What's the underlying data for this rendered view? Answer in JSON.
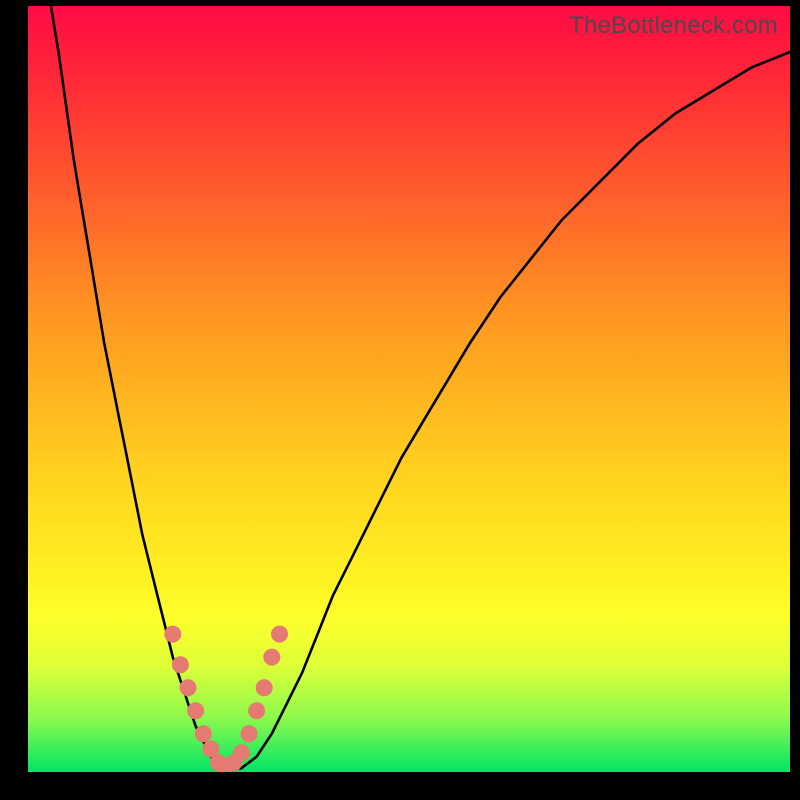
{
  "watermark": "TheBottleneck.com",
  "colors": {
    "gradient_top": "#ff0b47",
    "gradient_bottom": "#00e566",
    "curve": "#000000",
    "dots": "#e47a72",
    "frame": "#000000"
  },
  "chart_data": {
    "type": "line",
    "title": "",
    "xlabel": "",
    "ylabel": "",
    "xlim": [
      0,
      100
    ],
    "ylim": [
      0,
      100
    ],
    "x": [
      3,
      4,
      5,
      6,
      7,
      8,
      9,
      10,
      11,
      12,
      13,
      14,
      15,
      16,
      17,
      18,
      19,
      20,
      21,
      22,
      23,
      24,
      25,
      26,
      28,
      30,
      32,
      34,
      36,
      38,
      40,
      43,
      46,
      49,
      52,
      55,
      58,
      62,
      66,
      70,
      75,
      80,
      85,
      90,
      95,
      100
    ],
    "values": [
      100,
      94,
      87,
      80,
      74,
      68,
      62,
      56,
      51,
      46,
      41,
      36,
      31,
      27,
      23,
      19,
      15,
      12,
      9,
      6,
      4,
      2,
      1,
      0.3,
      0.5,
      2,
      5,
      9,
      13,
      18,
      23,
      29,
      35,
      41,
      46,
      51,
      56,
      62,
      67,
      72,
      77,
      82,
      86,
      89,
      92,
      94
    ],
    "notch_x": 25,
    "dots": [
      {
        "x": 19,
        "y": 18
      },
      {
        "x": 20,
        "y": 14
      },
      {
        "x": 21,
        "y": 11
      },
      {
        "x": 22,
        "y": 8
      },
      {
        "x": 23,
        "y": 5
      },
      {
        "x": 24,
        "y": 3
      },
      {
        "x": 25,
        "y": 1.2
      },
      {
        "x": 26,
        "y": 0.8
      },
      {
        "x": 27,
        "y": 1.2
      },
      {
        "x": 28,
        "y": 2.5
      },
      {
        "x": 29,
        "y": 5
      },
      {
        "x": 30,
        "y": 8
      },
      {
        "x": 31,
        "y": 11
      },
      {
        "x": 32,
        "y": 15
      },
      {
        "x": 33,
        "y": 18
      }
    ]
  }
}
